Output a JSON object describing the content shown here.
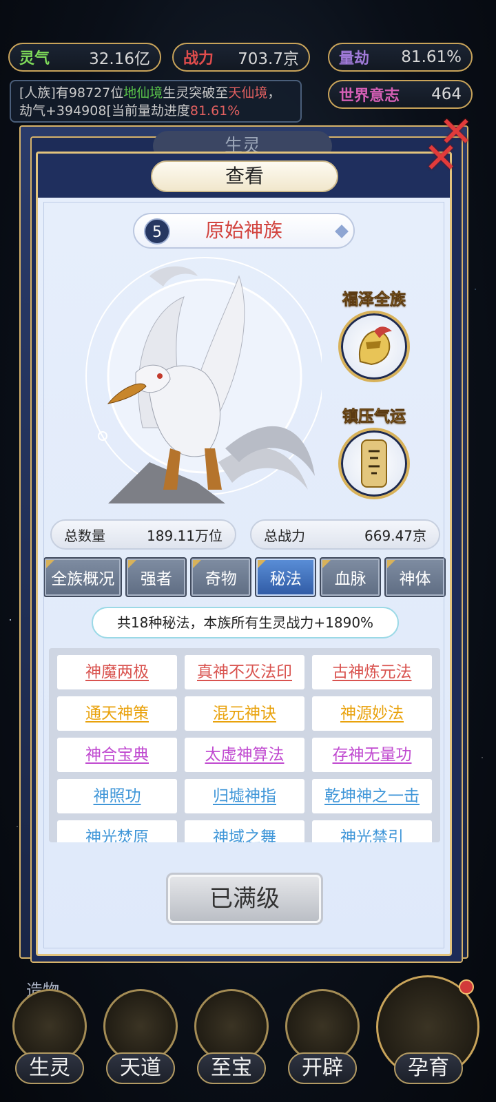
{
  "top_bar": {
    "lingqi": {
      "label": "灵气",
      "value": "32.16亿"
    },
    "zhanli": {
      "label": "战力",
      "value": "703.7京"
    },
    "liangjie": {
      "label": "量劫",
      "value": "81.61%"
    },
    "shijie": {
      "label": "世界意志",
      "value": "464"
    }
  },
  "news": {
    "p1": "[人族]有98727位",
    "realm": "地仙境",
    "p2": "生灵突破至",
    "realm2": "天仙境",
    "p3": "，劫气+394908[当前量劫进度",
    "progress": "81.61%"
  },
  "back_panel": {
    "title": "生灵"
  },
  "dialog": {
    "title": "查看",
    "race_level": "5",
    "race_name": "原始神族",
    "badge1_label": "福泽全族",
    "badge2_label": "镇压气运",
    "total_count": {
      "label": "总数量",
      "value": "189.11万位"
    },
    "total_power": {
      "label": "总战力",
      "value": "669.47京"
    },
    "tabs": [
      "全族概况",
      "强者",
      "奇物",
      "秘法",
      "血脉",
      "神体"
    ],
    "active_tab": "秘法",
    "info_text": "共18种秘法，本族所有生灵战力+1890%",
    "skills": [
      {
        "name": "神魔两极",
        "color": "#d9534f"
      },
      {
        "name": "真神不灭法印",
        "color": "#d9534f"
      },
      {
        "name": "古神炼元法",
        "color": "#d9534f"
      },
      {
        "name": "通天神策",
        "color": "#e9a20c"
      },
      {
        "name": "混元神诀",
        "color": "#e9a20c"
      },
      {
        "name": "神源妙法",
        "color": "#e9a20c"
      },
      {
        "name": "神合宝典",
        "color": "#c04ad0"
      },
      {
        "name": "太虚神算法",
        "color": "#c04ad0"
      },
      {
        "name": "存神无量功",
        "color": "#c04ad0"
      },
      {
        "name": "神照功",
        "color": "#3f96d8"
      },
      {
        "name": "归墟神指",
        "color": "#3f96d8"
      },
      {
        "name": "乾坤神之一击",
        "color": "#3f96d8"
      },
      {
        "name": "神光焚原",
        "color": "#3f96d8"
      },
      {
        "name": "神域之舞",
        "color": "#3f96d8"
      },
      {
        "name": "神光禁引",
        "color": "#3f96d8"
      }
    ],
    "max_button": "已满级"
  },
  "side_label": "造物",
  "bottom_nav": {
    "items": [
      "生灵",
      "天道",
      "至宝",
      "开辟"
    ],
    "main": "孕育"
  }
}
